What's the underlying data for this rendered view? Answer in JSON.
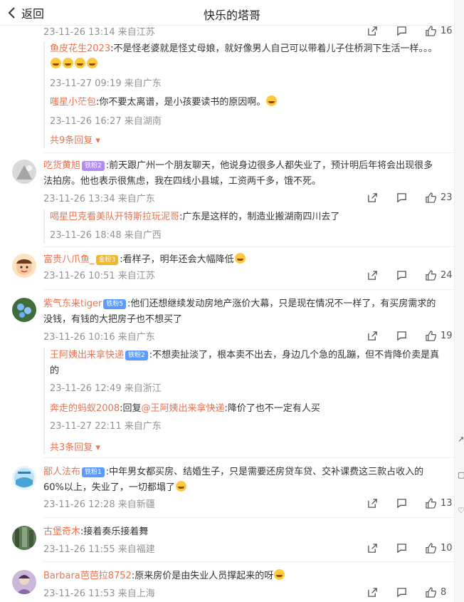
{
  "header": {
    "back_label": "返回",
    "title": "快乐的塔哥"
  },
  "top": {
    "time": "23-11-26 13:14 来自江苏",
    "likes": "16"
  },
  "thread1": {
    "replies": [
      {
        "user": "鱼皮花生2023",
        "text": ":不是怪老婆就是怪丈母娘，就好像男人自己可以带着儿子住桥洞下生活一样。。。",
        "time": "23-11-27 09:19 来自广东"
      },
      {
        "user": "嗤星小茫包",
        "text": ":你不要太离谱，是小孩要读书的原因啊。",
        "time": "23-11-26 16:27 来自湖南"
      }
    ],
    "more": "共9条回复"
  },
  "comments": [
    {
      "user": "吃货黄旭",
      "badge": "铁粉2",
      "text": ":前天跟广州一个朋友聊天，他说身边很多人都失业了，预计明后年将会出现很多法拍房。他也表示很焦虑，我在四线小县城，工资两千多，饿不死。",
      "time": "23-11-26 13:34 来自广东",
      "likes": "23"
    },
    {
      "user": "富贵八爪鱼_",
      "badge": "金粉3",
      "text": ":看样子，明年还会大幅降低",
      "time": "23-11-26 10:51 来自江苏",
      "likes": "24"
    },
    {
      "user": "紫气东来tiger",
      "badge": "铁粉5",
      "text": ":他们还想继续发动房地产涨价大幕，只是现在情况不一样了，有买房需求的没钱，有钱的大把房子也不想买了",
      "time": "23-11-26 10:16 来自广东",
      "likes": "19"
    },
    {
      "user": "鄙人法布",
      "badge": "铁粉1",
      "text": ":中年男女都买房、结婚生子，只是需要还房贷车贷、交补课费这三款占收入的60%以上，失业了，一切都塌了",
      "time": "23-11-26 12:28 来自新疆",
      "likes": "13"
    },
    {
      "user": "古堡奇木",
      "badge": "",
      "text": ":接着奏乐接着舞",
      "time": "23-11-26 11:55 来自福建",
      "likes": "10"
    },
    {
      "user": "Barbara芭芭拉8752",
      "badge": "",
      "text": ":原来房价是由失业人员撑起来的呀",
      "time": "23-11-26 11:53 来自上海",
      "likes": "8"
    }
  ],
  "thread2": {
    "user": "喝星巴克看美队开特斯拉玩泥哥",
    "text": ":广东是这样的，制造业搬湖南四川去了",
    "time": "23-11-26 18:48 来自广西"
  },
  "thread3": {
    "r1": {
      "user": "王阿姨出来拿快递",
      "badge": "铁粉2",
      "text": ":不想卖扯淡了，根本卖不出去，身边几个急的乱蹦，但不肯降价卖是真的",
      "time": "23-11-26 12:49 来自浙江"
    },
    "r2": {
      "user": "奔走的蚂蚁2008",
      "prefix": ":回复",
      "mention": "@王阿姨出来拿快递",
      "text": ":降价了也不一定有人买",
      "time": "23-11-27 22:11 来自广东"
    },
    "more": "共3条回复"
  },
  "colors": {
    "accent": "#eb7350",
    "meta": "#939393",
    "badge_blue": "#5b9bff",
    "badge_purple": "#b38bf2",
    "badge_gold": "#f4b52e"
  }
}
